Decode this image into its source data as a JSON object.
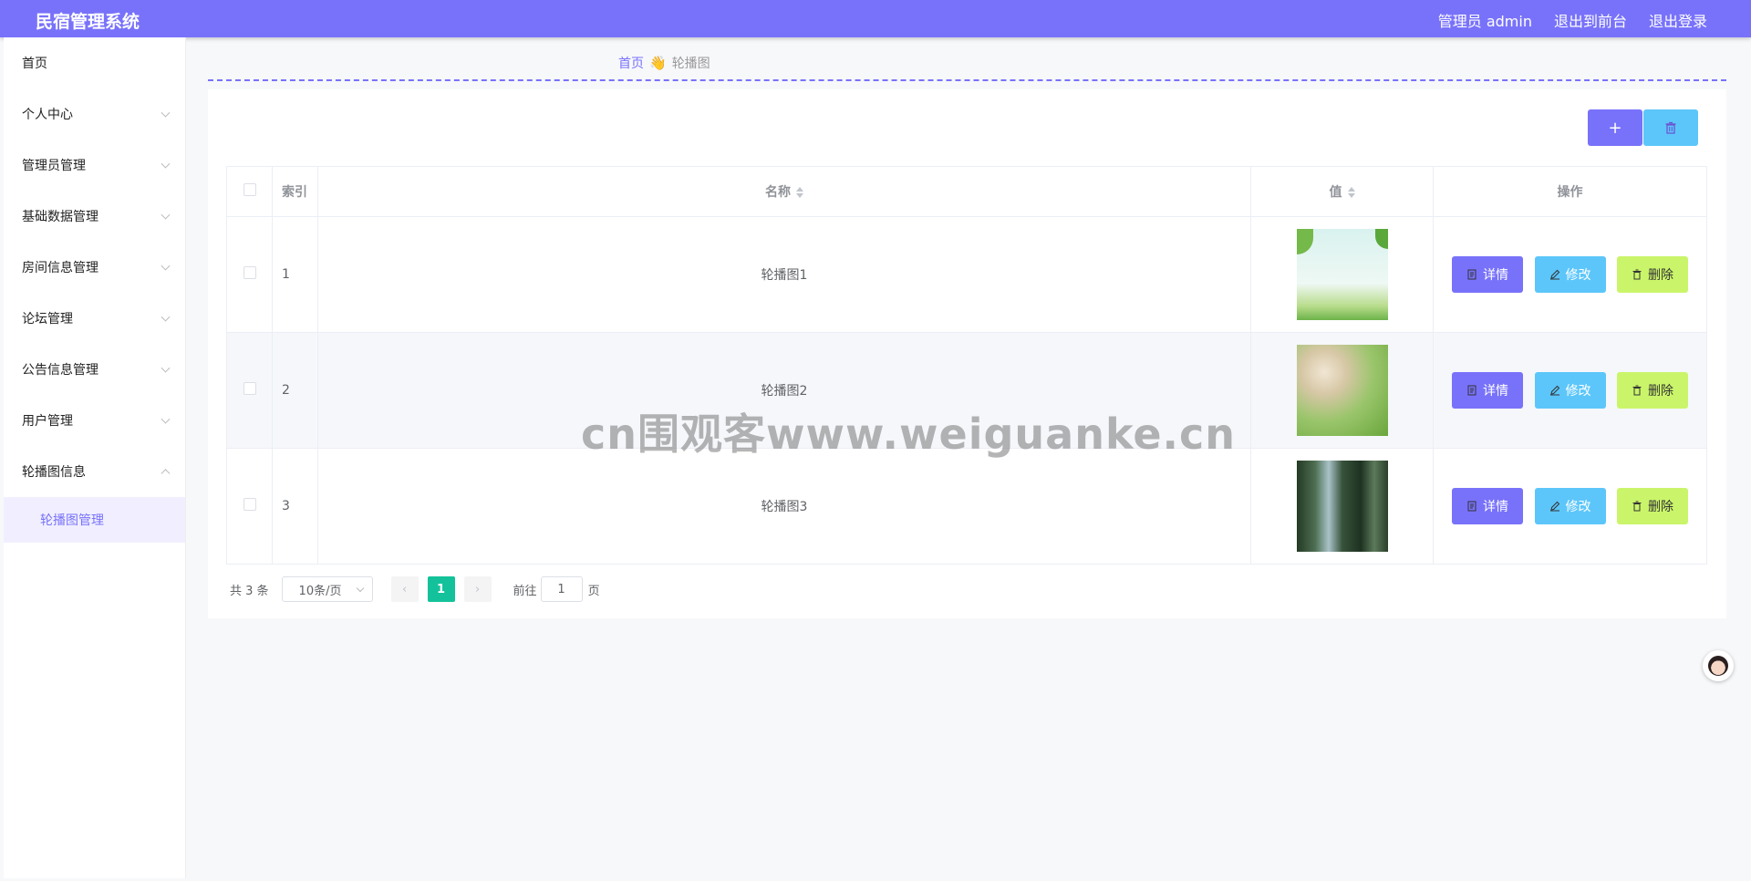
{
  "header": {
    "title": "民宿管理系统",
    "user_label": "管理员 admin",
    "to_frontend": "退出到前台",
    "logout": "退出登录"
  },
  "sidebar": {
    "items": [
      {
        "label": "首页",
        "has_children": false
      },
      {
        "label": "个人中心",
        "has_children": true
      },
      {
        "label": "管理员管理",
        "has_children": true
      },
      {
        "label": "基础数据管理",
        "has_children": true
      },
      {
        "label": "房间信息管理",
        "has_children": true
      },
      {
        "label": "论坛管理",
        "has_children": true
      },
      {
        "label": "公告信息管理",
        "has_children": true
      },
      {
        "label": "用户管理",
        "has_children": true
      },
      {
        "label": "轮播图信息",
        "has_children": true,
        "expanded": true
      }
    ],
    "active_sub": "轮播图管理"
  },
  "breadcrumb": {
    "home": "首页",
    "separator": "👋",
    "current": "轮播图"
  },
  "toolbar": {
    "add_icon": "+",
    "delete_icon": "trash-icon"
  },
  "table": {
    "headers": {
      "index": "索引",
      "name": "名称",
      "value": "值",
      "actions": "操作"
    },
    "rows": [
      {
        "index": "1",
        "name": "轮播图1",
        "image": "thumb1"
      },
      {
        "index": "2",
        "name": "轮播图2",
        "image": "thumb2"
      },
      {
        "index": "3",
        "name": "轮播图3",
        "image": "thumb3"
      }
    ],
    "actions": {
      "detail": "详情",
      "edit": "修改",
      "remove": "删除"
    }
  },
  "pagination": {
    "total": "共 3 条",
    "page_size": "10条/页",
    "current_page": "1",
    "goto_label": "前往",
    "goto_value": "1",
    "page_suffix": "页"
  },
  "watermark": "cn围观客www.weiguanke.cn",
  "colors": {
    "primary": "#7872fa",
    "info": "#5cc6fa",
    "warning": "#caf56a",
    "success": "#13c29a"
  }
}
